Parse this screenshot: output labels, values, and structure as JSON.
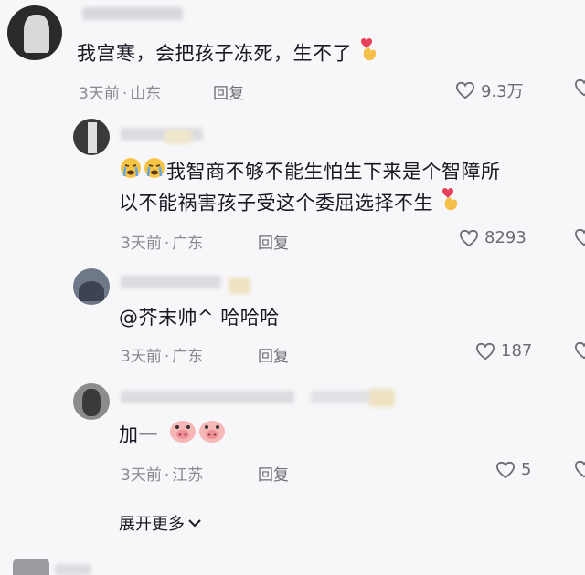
{
  "comments": [
    {
      "text": "我宫寒，会把孩子冻死，生不了",
      "time": "3天前",
      "location": "山东",
      "reply": "回复",
      "likes": "9.3万"
    },
    {
      "text_line1": "我智商不够不能生怕生下来是个智障所",
      "text_line2": "以不能祸害孩子受这个委屈选择不生",
      "time": "3天前",
      "location": "广东",
      "reply": "回复",
      "likes": "8293"
    },
    {
      "text": "@芥末帅^ 哈哈哈",
      "time": "3天前",
      "location": "广东",
      "reply": "回复",
      "likes": "187"
    },
    {
      "text": "加一",
      "time": "3天前",
      "location": "江苏",
      "reply": "回复",
      "likes": "5"
    }
  ],
  "expand_label": "展开更多",
  "separator": "·",
  "icons": {
    "like": "heart-outline-icon",
    "finger_heart": "finger-heart-emoji-icon",
    "crying": "crying-face-emoji-icon",
    "pig": "pig-face-emoji-icon",
    "chevron": "chevron-down-icon"
  },
  "colors": {
    "background": "#f7f7f9",
    "text": "#161823",
    "meta": "#8a8b91"
  }
}
